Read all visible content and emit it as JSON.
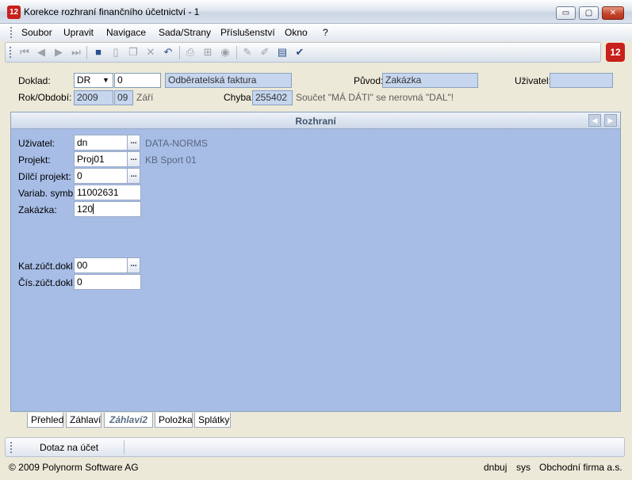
{
  "window": {
    "title": "Korekce rozhraní finančního účetnictví - 1",
    "logo": "12",
    "min": "▭",
    "max": "▢",
    "close": "✕"
  },
  "menu": [
    "Soubor",
    "Upravit",
    "Navigace",
    "Sada/Strany",
    "Příslušenství",
    "Okno",
    "?"
  ],
  "toolbar": {
    "icons": [
      "first-icon",
      "prev-icon",
      "next-icon",
      "last-icon",
      "save-icon",
      "new-icon",
      "copy-icon",
      "delete-icon",
      "undo-icon",
      "print-icon",
      "tree-icon",
      "disk-icon",
      "edit-icon",
      "pencil-icon",
      "form-icon",
      "check-icon"
    ]
  },
  "header": {
    "doklad_label": "Doklad:",
    "doklad_type": "DR",
    "doklad_number": "0",
    "doklad_desc": "Odběratelská faktura",
    "puvod_label": "Původ:",
    "puvod_value": "Zakázka",
    "uzivatel_label": "Uživatel:",
    "uzivatel_value": "",
    "rok_label": "Rok/Období:",
    "rok_value": "2009",
    "obdobi_value": "09",
    "mesic": "Září",
    "chyba_label": "Chyba:",
    "chyba_value": "255402",
    "chyba_message": "Součet \"MÁ DÁTI\" se nerovná \"DAL\"!"
  },
  "panel": {
    "title": "Rozhraní",
    "fields": {
      "uzivatel": {
        "label": "Uživatel:",
        "value": "dn",
        "desc": "DATA-NORMS"
      },
      "projekt": {
        "label": "Projekt:",
        "value": "Proj01",
        "desc": "KB Sport 01"
      },
      "dilci": {
        "label": "Dílčí projekt:",
        "value": "0"
      },
      "variab": {
        "label": "Variab. symb.:",
        "value": "11002631"
      },
      "zakazka": {
        "label": "Zakázka:",
        "value": "120"
      },
      "katzuct": {
        "label": "Kat.zúčt.dokl.:",
        "value": "00"
      },
      "ciszuct": {
        "label": "Čís.zúčt.dokl.:",
        "value": "0"
      }
    },
    "dots": "..."
  },
  "tabs": [
    "Přehled",
    "Záhlaví",
    "Záhlaví2",
    "Položka",
    "Splátky"
  ],
  "bottom": {
    "button": "Dotaz na účet"
  },
  "status": {
    "copyright": "© 2009 Polynorm Software AG",
    "user": "dnbuj",
    "system": "sys",
    "company": "Obchodní firma a.s."
  }
}
